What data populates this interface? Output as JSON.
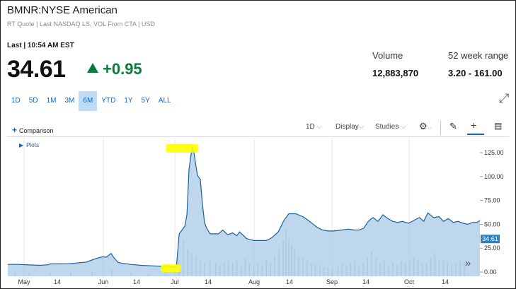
{
  "header": {
    "title": "BMNR:NYSE American",
    "subtitle": "RT Quote | Last NASDAQ LS, VOL From CTA | USD",
    "last_time": "Last | 10:54 AM EST",
    "price": "34.61",
    "change": "+0.95",
    "change_color": "#0c7a3b"
  },
  "stats": {
    "volume_label": "Volume",
    "volume_value": "12,883,870",
    "range_label": "52 week range",
    "range_value": "3.20 - 161.00"
  },
  "ranges": [
    "1D",
    "5D",
    "1M",
    "3M",
    "6M",
    "YTD",
    "1Y",
    "5Y",
    "ALL"
  ],
  "active_range": "6M",
  "toolbar": {
    "comparison_label": "Comparison",
    "interval_label": "1D",
    "display_label": "Display",
    "studies_label": "Studies",
    "plots_label": "Plots"
  },
  "chart_data": {
    "type": "area",
    "x_ticks": [
      "May",
      "14",
      "Jun",
      "14",
      "Jul",
      "14",
      "Aug",
      "14",
      "Sep",
      "14",
      "Oct",
      "14"
    ],
    "y_ticks": [
      "125.00",
      "100.00",
      "75.00",
      "50.00",
      "25.00",
      "0.00"
    ],
    "ylim": [
      0,
      135
    ],
    "last_price_label": "34.61",
    "line_color": "#1f5f99",
    "fill_color": "#a9c9e6",
    "volume_color": "#c8c8c8",
    "highlight_color": "#ffff00",
    "price_series": [
      [
        0,
        8
      ],
      [
        15,
        8
      ],
      [
        30,
        7.5
      ],
      [
        45,
        7
      ],
      [
        58,
        7.6
      ],
      [
        60,
        8.5
      ],
      [
        72,
        8.6
      ],
      [
        85,
        8.7
      ],
      [
        98,
        9.5
      ],
      [
        112,
        10.5
      ],
      [
        125,
        14
      ],
      [
        135,
        16
      ],
      [
        140,
        15.5
      ],
      [
        147,
        19.5
      ],
      [
        150,
        16
      ],
      [
        157,
        10
      ],
      [
        165,
        9
      ],
      [
        175,
        8
      ],
      [
        190,
        7
      ],
      [
        205,
        6.5
      ],
      [
        220,
        6
      ],
      [
        235,
        5.5
      ],
      [
        240,
        5.5
      ],
      [
        244,
        40
      ],
      [
        252,
        48
      ],
      [
        255,
        60
      ],
      [
        258,
        108
      ],
      [
        261,
        124
      ],
      [
        263,
        131
      ],
      [
        265,
        125
      ],
      [
        267,
        115
      ],
      [
        270,
        101
      ],
      [
        272,
        99
      ],
      [
        274,
        97
      ],
      [
        277,
        72
      ],
      [
        280,
        52
      ],
      [
        283,
        46
      ],
      [
        288,
        40
      ],
      [
        300,
        40
      ],
      [
        306,
        44
      ],
      [
        313,
        39
      ],
      [
        320,
        41
      ],
      [
        326,
        38
      ],
      [
        330,
        42
      ],
      [
        340,
        35
      ],
      [
        350,
        33
      ],
      [
        360,
        33
      ],
      [
        368,
        33
      ],
      [
        376,
        36
      ],
      [
        385,
        42
      ],
      [
        393,
        54
      ],
      [
        400,
        61
      ],
      [
        410,
        61
      ],
      [
        420,
        58
      ],
      [
        426,
        55
      ],
      [
        433,
        51
      ],
      [
        440,
        47
      ],
      [
        448,
        44
      ],
      [
        456,
        43
      ],
      [
        465,
        43
      ],
      [
        475,
        44
      ],
      [
        485,
        45
      ],
      [
        493,
        44
      ],
      [
        500,
        44
      ],
      [
        507,
        46
      ],
      [
        512,
        52
      ],
      [
        516,
        55
      ],
      [
        520,
        57
      ],
      [
        527,
        53
      ],
      [
        534,
        60
      ],
      [
        541,
        56
      ],
      [
        548,
        53
      ],
      [
        555,
        52
      ],
      [
        562,
        53
      ],
      [
        570,
        51
      ],
      [
        578,
        54
      ],
      [
        586,
        57
      ],
      [
        592,
        53
      ],
      [
        598,
        62
      ],
      [
        606,
        57
      ],
      [
        614,
        58
      ],
      [
        620,
        53
      ],
      [
        627,
        56
      ],
      [
        634,
        52
      ],
      [
        641,
        53
      ],
      [
        648,
        51
      ],
      [
        655,
        50
      ],
      [
        662,
        52
      ],
      [
        668,
        52
      ],
      [
        672,
        54
      ]
    ],
    "volume_series": [
      [
        10,
        1.5
      ],
      [
        30,
        1.4
      ],
      [
        60,
        1.3
      ],
      [
        90,
        1.7
      ],
      [
        120,
        1.9
      ],
      [
        148,
        2.8
      ],
      [
        175,
        1.5
      ],
      [
        200,
        1.0
      ],
      [
        225,
        0.9
      ],
      [
        244,
        7
      ],
      [
        250,
        16
      ],
      [
        256,
        12
      ],
      [
        262,
        10
      ],
      [
        268,
        9
      ],
      [
        274,
        7
      ],
      [
        280,
        6
      ],
      [
        288,
        7
      ],
      [
        296,
        6
      ],
      [
        302,
        5
      ],
      [
        308,
        6
      ],
      [
        314,
        7
      ],
      [
        320,
        6
      ],
      [
        326,
        7
      ],
      [
        332,
        5
      ],
      [
        338,
        8
      ],
      [
        344,
        6
      ],
      [
        350,
        5
      ],
      [
        356,
        6
      ],
      [
        362,
        5
      ],
      [
        368,
        7
      ],
      [
        374,
        6
      ],
      [
        380,
        9
      ],
      [
        386,
        12
      ],
      [
        392,
        16
      ],
      [
        396,
        21
      ],
      [
        400,
        17
      ],
      [
        404,
        14
      ],
      [
        408,
        12
      ],
      [
        414,
        9
      ],
      [
        420,
        8
      ],
      [
        426,
        7
      ],
      [
        432,
        6
      ],
      [
        438,
        5
      ],
      [
        444,
        5
      ],
      [
        450,
        4
      ],
      [
        456,
        4
      ],
      [
        462,
        4
      ],
      [
        470,
        5
      ],
      [
        476,
        6
      ],
      [
        482,
        5
      ],
      [
        488,
        6
      ],
      [
        494,
        7
      ],
      [
        500,
        5
      ],
      [
        506,
        6
      ],
      [
        512,
        8
      ],
      [
        518,
        11
      ],
      [
        524,
        8
      ],
      [
        530,
        6
      ],
      [
        536,
        7
      ],
      [
        542,
        5
      ],
      [
        548,
        6
      ],
      [
        554,
        5
      ],
      [
        560,
        7
      ],
      [
        566,
        6
      ],
      [
        572,
        7
      ],
      [
        578,
        8
      ],
      [
        584,
        7
      ],
      [
        590,
        6
      ],
      [
        596,
        6
      ],
      [
        602,
        8
      ],
      [
        608,
        10
      ],
      [
        614,
        7
      ],
      [
        620,
        7
      ],
      [
        626,
        6
      ],
      [
        632,
        5
      ],
      [
        638,
        6
      ],
      [
        644,
        7
      ],
      [
        650,
        6
      ]
    ]
  }
}
